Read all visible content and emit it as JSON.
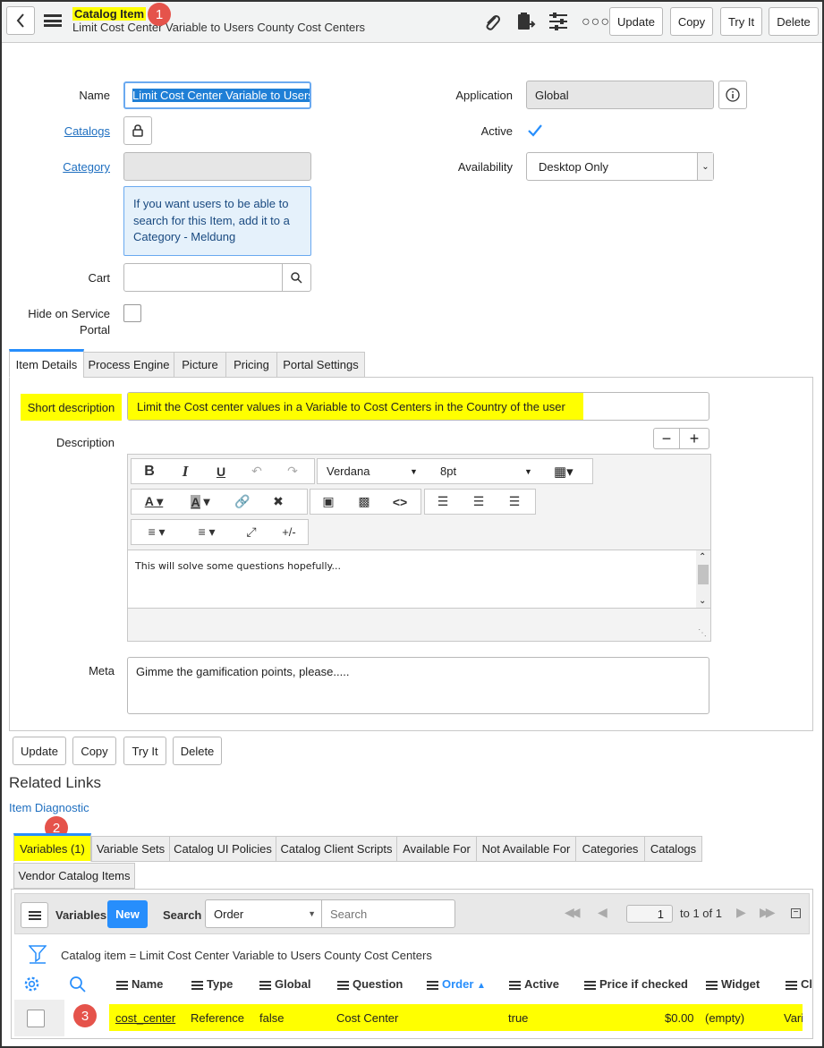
{
  "header": {
    "title": "Catalog Item",
    "subtitle": "Limit Cost Center Variable to Users County Cost Centers",
    "buttons": {
      "update": "Update",
      "copy": "Copy",
      "try_it": "Try It",
      "delete": "Delete"
    }
  },
  "badges": {
    "one": "1",
    "two": "2",
    "three": "3"
  },
  "form": {
    "name_label": "Name",
    "name_value": "Limit Cost Center Variable to Users",
    "catalogs_label": "Catalogs",
    "category_label": "Category",
    "category_value": "",
    "info_text": "If you want users to be able to search for this Item, add it to a Category - Meldung",
    "cart_label": "Cart",
    "cart_value": "",
    "hide_label": "Hide on Service Portal",
    "application_label": "Application",
    "application_value": "Global",
    "active_label": "Active",
    "active_checked": true,
    "availability_label": "Availability",
    "availability_value": "Desktop Only"
  },
  "tabs": [
    "Item Details",
    "Process Engine",
    "Picture",
    "Pricing",
    "Portal Settings"
  ],
  "details": {
    "short_desc_label": "Short description",
    "short_desc_value": "Limit the Cost center values in a Variable to Cost Centers in the Country of the user",
    "description_label": "Description",
    "font_name": "Verdana",
    "font_size": "8pt",
    "strike_label": "+/-",
    "description_text": "This will solve some questions hopefully...",
    "meta_label": "Meta",
    "meta_value": "Gimme the gamification points, please....."
  },
  "bottom_buttons": {
    "update": "Update",
    "copy": "Copy",
    "try_it": "Try It",
    "delete": "Delete"
  },
  "related": {
    "title": "Related Links",
    "item_diagnostic": "Item Diagnostic"
  },
  "related_tabs": [
    "Variables (1)",
    "Variable Sets",
    "Catalog UI Policies",
    "Catalog Client Scripts",
    "Available For",
    "Not Available For",
    "Categories",
    "Catalogs",
    "Vendor Catalog Items"
  ],
  "list": {
    "title": "Variables",
    "new_label": "New",
    "search_label": "Search",
    "search_field": "Order",
    "search_placeholder": "Search",
    "page_value": "1",
    "page_of": "to 1 of 1",
    "filter_text": "Catalog item = Limit Cost Center Variable to Users County Cost Centers",
    "columns": [
      "Name",
      "Type",
      "Global",
      "Question",
      "Order",
      "Active",
      "Price if checked",
      "Widget",
      "Cl"
    ],
    "row": {
      "name": "cost_center",
      "type": "Reference",
      "global": "false",
      "question": "Cost Center",
      "order": "",
      "active": "true",
      "price": "$0.00",
      "widget": "(empty)",
      "class": "Varia"
    }
  },
  "colors": {
    "accent": "#278efc",
    "highlight": "#ffff00",
    "badge": "#e5534b",
    "link": "#1f6fc0"
  }
}
